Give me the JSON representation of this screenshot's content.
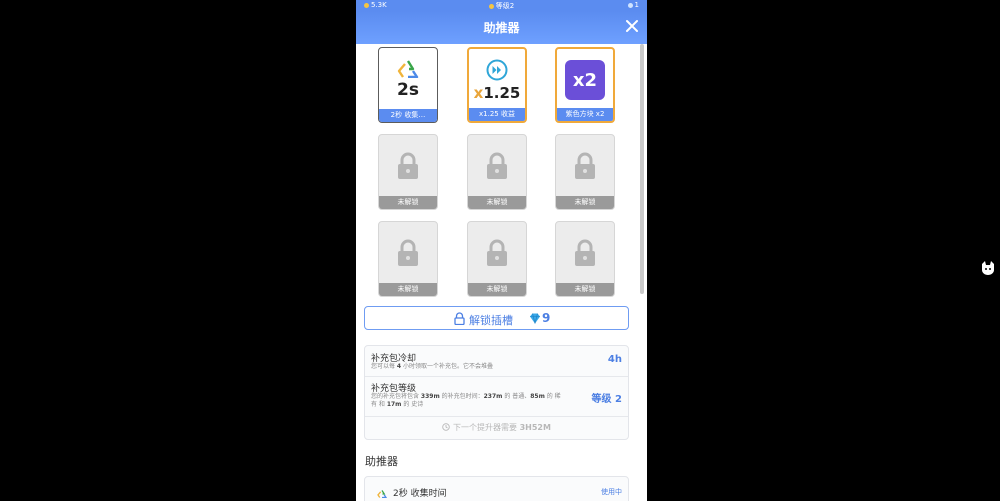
{
  "statusbar": {
    "currency": "5.3K",
    "level": "等级2",
    "right_count": "1"
  },
  "header": {
    "title": "助推器"
  },
  "slots": [
    {
      "kind": "active",
      "art_text": "2s",
      "caption": "2秒 收集…",
      "icon": "recycle-icon"
    },
    {
      "kind": "active",
      "art_prefix": "x",
      "art_text": "1.25",
      "caption": "x1.25 收益",
      "icon": "fast-forward-icon"
    },
    {
      "kind": "active",
      "art_text": "x2",
      "caption": "紫色方块 x2",
      "icon": "purple-block-icon",
      "art_color": "#6b4fd8"
    },
    {
      "kind": "locked",
      "caption": "未解锁",
      "icon": "lock-icon"
    },
    {
      "kind": "locked",
      "caption": "未解锁",
      "icon": "lock-icon"
    },
    {
      "kind": "locked",
      "caption": "未解锁",
      "icon": "lock-icon"
    },
    {
      "kind": "locked",
      "caption": "未解锁",
      "icon": "lock-icon"
    },
    {
      "kind": "locked",
      "caption": "未解锁",
      "icon": "lock-icon"
    },
    {
      "kind": "locked",
      "caption": "未解锁",
      "icon": "lock-icon"
    }
  ],
  "unlock": {
    "label": "解锁插槽",
    "cost": "9",
    "icon": "gem-icon"
  },
  "info": {
    "cooldown_title": "补充包冷却",
    "cooldown_desc_1": "您可以每 ",
    "cooldown_desc_num": "4",
    "cooldown_desc_2": " 小时领取一个补充包。它不会堆叠",
    "cooldown_value": "4h",
    "level_title": "补充包等级",
    "level_desc_a": "您的补充包将包含 ",
    "level_desc_total": "339m",
    "level_desc_b": " 的补充包时间：",
    "level_desc_normal": "237m",
    "level_desc_c": " 的 普通、",
    "level_desc_rare": "85m",
    "level_desc_d": " 的 稀",
    "level_desc_e": "有 和 ",
    "level_desc_epic": "17m",
    "level_desc_f": " 的 史诗",
    "level_value": "等级 2",
    "next_boost": "下一个提升器需要 ",
    "next_boost_time": "3H52M"
  },
  "section": {
    "title": "助推器"
  },
  "booster": {
    "name": "2秒 收集时间",
    "status": "使用中",
    "icon_label": "2s"
  },
  "colors": {
    "accent": "#5b8cf0",
    "gold": "#f0a93a",
    "purple": "#6b4fd8",
    "locked": "#9a9a9a"
  }
}
